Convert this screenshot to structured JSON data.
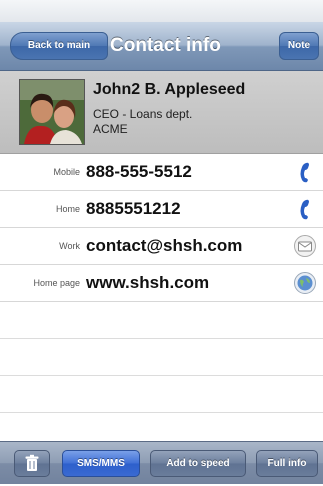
{
  "nav": {
    "back_label": "Back to main",
    "title": "Contact info",
    "note_label": "Note"
  },
  "contact": {
    "name": "John2 B. Appleseed",
    "title": "CEO - Loans dept.",
    "company": "ACME"
  },
  "fields": [
    {
      "label": "Mobile",
      "value": "888-555-5512",
      "icon": "phone-icon"
    },
    {
      "label": "Home",
      "value": "8885551212",
      "icon": "phone-icon"
    },
    {
      "label": "Work",
      "value": "contact@shsh.com",
      "icon": "mail-icon"
    },
    {
      "label": "Home page",
      "value": "www.shsh.com",
      "icon": "globe-icon"
    }
  ],
  "toolbar": {
    "trash_icon": "trash-icon",
    "sms_label": "SMS/MMS",
    "speed_label": "Add to speed",
    "info_label": "Full info"
  },
  "colors": {
    "nav_button": "#4f78b4",
    "phone_icon": "#2a5fc4",
    "sms_button": "#3f6fd6"
  }
}
